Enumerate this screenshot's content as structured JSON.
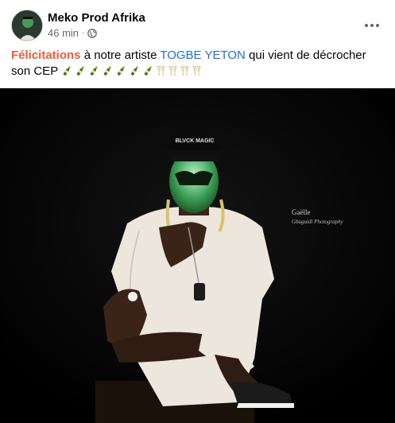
{
  "post": {
    "author": "Meko Prod Afrika",
    "time": "46 min",
    "separator": "·",
    "more_icon": "ellipsis-horizontal-icon",
    "privacy_icon": "globe-icon",
    "text_parts": {
      "highlight": "Félicitations",
      "middle": " à notre artiste ",
      "artist": "TOGBE YETON",
      "end": " qui vient de décrocher son CEP "
    },
    "emoji_bottles": 7,
    "emoji_glasses": 4,
    "photo": {
      "cap_text": "BLVCK MAGIC",
      "watermark_line1": "Gaëlle",
      "watermark_line2": "Gbaguidi Photography"
    }
  }
}
